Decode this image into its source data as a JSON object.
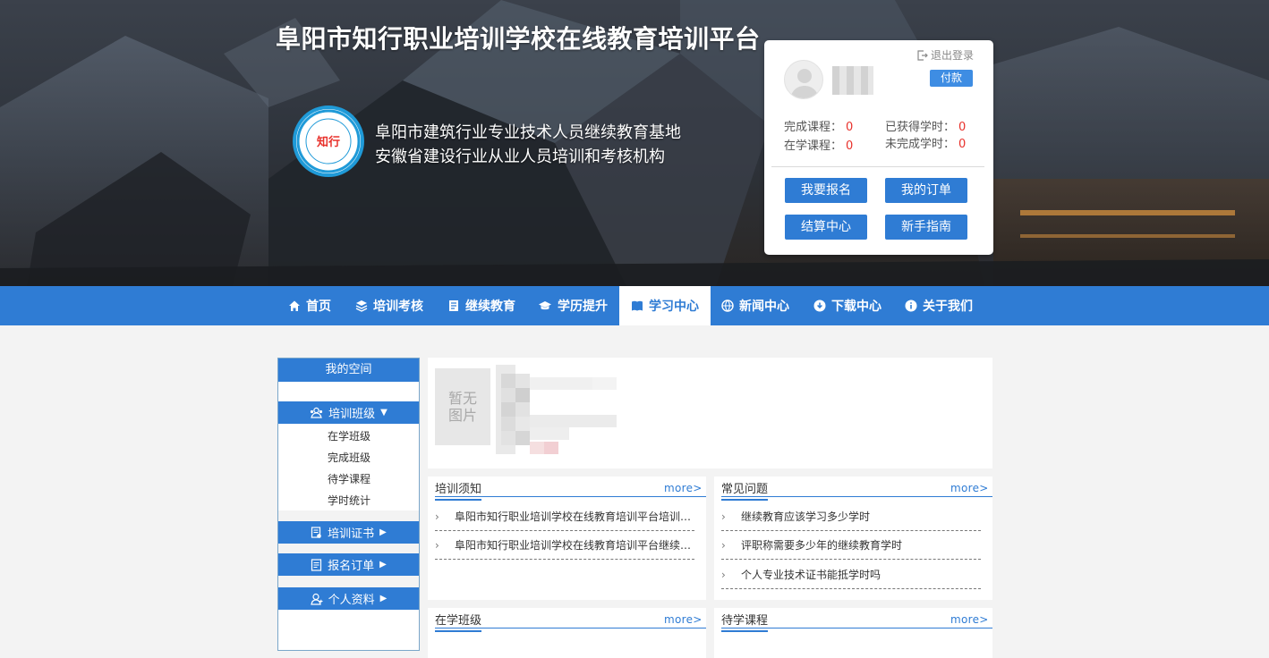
{
  "header": {
    "site_title": "阜阳市知行职业培训学校在线教育培训平台",
    "subtitle_line1": "阜阳市建筑行业专业技术人员继续教育基地",
    "subtitle_line2": "安徽省建设行业从业人员培训和考核机构",
    "logo_text": "知行"
  },
  "user_card": {
    "logout_label": "退出登录",
    "pay_label": "付款",
    "stats": [
      {
        "label": "完成课程：",
        "value": "0"
      },
      {
        "label": "已获得学时：",
        "value": "0"
      },
      {
        "label": "在学课程：",
        "value": "0"
      },
      {
        "label": "未完成学时：",
        "value": "0"
      }
    ],
    "buttons": [
      "我要报名",
      "我的订单",
      "结算中心",
      "新手指南"
    ]
  },
  "nav": {
    "items": [
      {
        "label": "首页",
        "icon": "home-icon"
      },
      {
        "label": "培训考核",
        "icon": "layers-icon"
      },
      {
        "label": "继续教育",
        "icon": "document-icon"
      },
      {
        "label": "学历提升",
        "icon": "graduation-cap-icon"
      },
      {
        "label": "学习中心",
        "icon": "book-icon",
        "active": true
      },
      {
        "label": "新闻中心",
        "icon": "globe-icon"
      },
      {
        "label": "下载中心",
        "icon": "download-icon"
      },
      {
        "label": "关于我们",
        "icon": "info-icon"
      }
    ]
  },
  "sidebar": {
    "title": "我的空间",
    "sections": [
      {
        "label": "培训班级",
        "arrow": "▼",
        "icon": "class-icon",
        "items": [
          "在学班级",
          "完成班级",
          "待学课程",
          "学时统计"
        ]
      },
      {
        "label": "培训证书",
        "arrow": "▶",
        "icon": "certificate-icon"
      },
      {
        "label": "报名订单",
        "arrow": "▶",
        "icon": "order-icon"
      },
      {
        "label": "个人资料",
        "arrow": "▶",
        "icon": "user-icon"
      }
    ]
  },
  "profile": {
    "no_photo_line1": "暂无",
    "no_photo_line2": "图片"
  },
  "panels": {
    "notice": {
      "title": "培训须知",
      "more": "more>",
      "items": [
        "阜阳市知行职业培训学校在线教育培训平台培训须知",
        "阜阳市知行职业培训学校在线教育培训平台继续教育须知"
      ]
    },
    "faq": {
      "title": "常见问题",
      "more": "more>",
      "items": [
        "继续教育应该学习多少学时",
        "评职称需要多少年的继续教育学时",
        "个人专业技术证书能抵学时吗"
      ]
    },
    "current_class": {
      "title": "在学班级",
      "more": "more>"
    },
    "pending_course": {
      "title": "待学课程",
      "more": "more>"
    }
  },
  "colors": {
    "primary": "#2f7cd4",
    "pay_button": "#3e8de3",
    "stat_number": "#e8322c",
    "logo_ring": "#1f9ad8"
  }
}
